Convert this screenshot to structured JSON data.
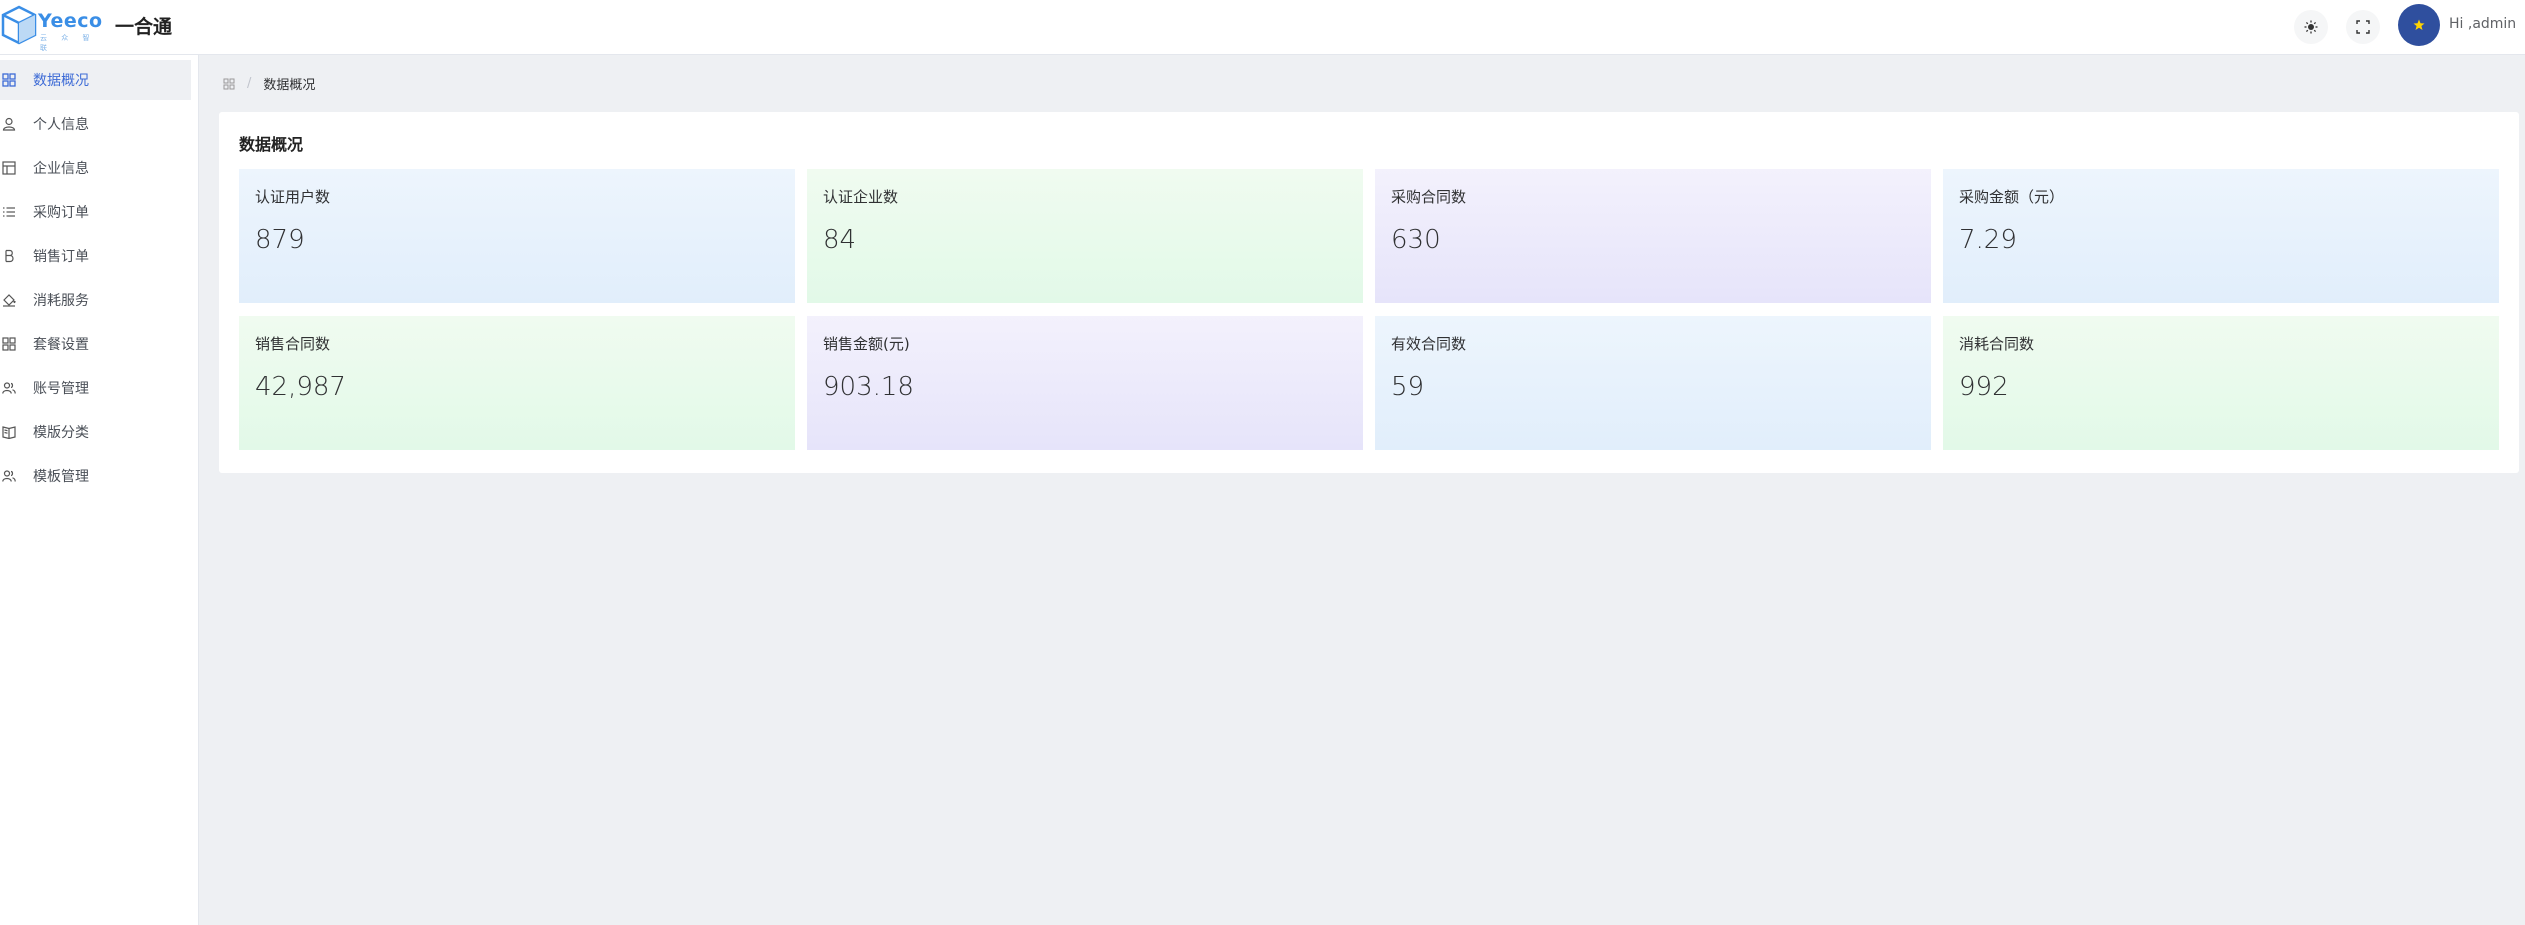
{
  "header": {
    "logo_text": "Yeeco",
    "logo_sub": "云 众 智 联",
    "app_title": "一合通",
    "greeting": "Hi ,admin"
  },
  "sidebar": {
    "items": [
      {
        "label": "数据概况",
        "icon": "grid-icon",
        "active": true
      },
      {
        "label": "个人信息",
        "icon": "user-icon"
      },
      {
        "label": "企业信息",
        "icon": "building-icon"
      },
      {
        "label": "采购订单",
        "icon": "list-icon"
      },
      {
        "label": "销售订单",
        "icon": "bitcoin-icon"
      },
      {
        "label": "消耗服务",
        "icon": "bucket-icon"
      },
      {
        "label": "套餐设置",
        "icon": "grid-icon"
      },
      {
        "label": "账号管理",
        "icon": "users-icon"
      },
      {
        "label": "模版分类",
        "icon": "book-icon"
      },
      {
        "label": "模板管理",
        "icon": "users-icon"
      }
    ]
  },
  "breadcrumb": {
    "separator": "/",
    "current": "数据概况"
  },
  "overview": {
    "title": "数据概况",
    "cards": [
      {
        "label": "认证用户数",
        "value": "879"
      },
      {
        "label": "认证企业数",
        "value": "84"
      },
      {
        "label": "采购合同数",
        "value": "630"
      },
      {
        "label": "采购金额（元）",
        "value": "7.29"
      },
      {
        "label": "销售合同数",
        "value": "42,987"
      },
      {
        "label": "销售金额(元)",
        "value": "903.18"
      },
      {
        "label": "有效合同数",
        "value": "59"
      },
      {
        "label": "消耗合同数",
        "value": "992"
      }
    ]
  },
  "colors": {
    "accent": "#3d6bd6",
    "avatar": "#2f4f9e",
    "card_blue": "#e6f1fc",
    "card_green": "#e8faec",
    "card_purple": "#ebe9fb"
  }
}
